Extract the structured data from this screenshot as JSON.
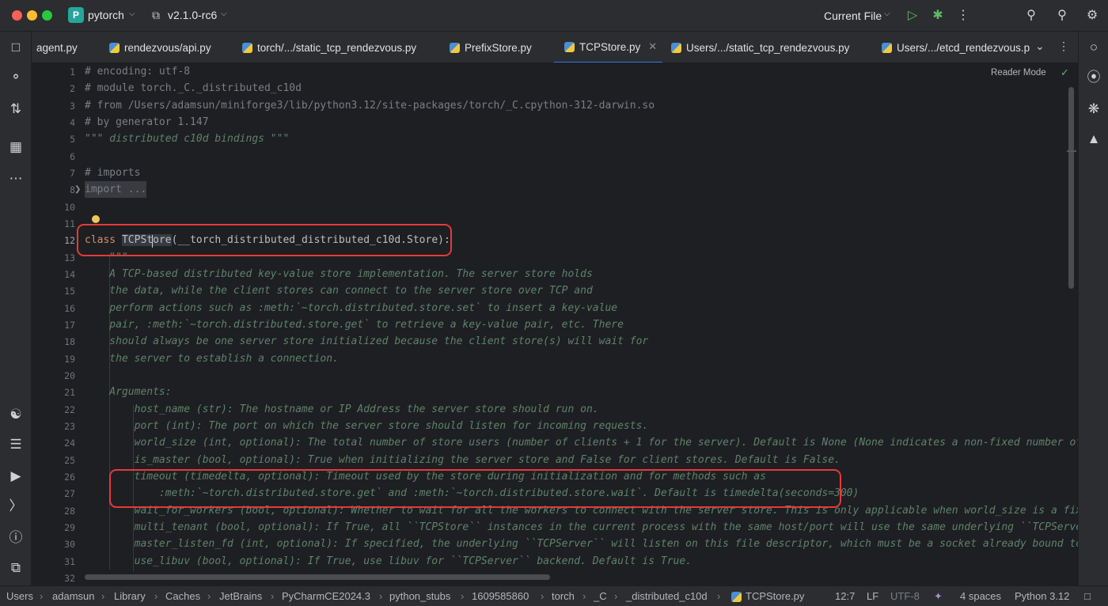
{
  "titlebar": {
    "project_badge": "P",
    "project_name": "pytorch",
    "branch": "v2.1.0-rc6",
    "run_config": "Current File"
  },
  "tabs": [
    {
      "label": "agent.py",
      "active": false
    },
    {
      "label": "rendezvous/api.py",
      "active": false
    },
    {
      "label": "torch/.../static_tcp_rendezvous.py",
      "active": false
    },
    {
      "label": "PrefixStore.py",
      "active": false
    },
    {
      "label": "TCPStore.py",
      "active": true
    },
    {
      "label": "Users/.../static_tcp_rendezvous.py",
      "active": false
    },
    {
      "label": "Users/.../etcd_rendezvous.p",
      "active": false
    }
  ],
  "editor": {
    "reader_mode": "Reader Mode",
    "line_numbers": [
      "1",
      "2",
      "3",
      "4",
      "5",
      "6",
      "7",
      "8",
      "10",
      "11",
      "12",
      "13",
      "14",
      "15",
      "16",
      "17",
      "18",
      "19",
      "20",
      "21",
      "22",
      "23",
      "24",
      "25",
      "26",
      "27",
      "28",
      "29",
      "30",
      "31",
      "32"
    ],
    "lines": {
      "l1": "# encoding: utf-8",
      "l2": "# module torch._C._distributed_c10d",
      "l3": "# from /Users/adamsun/miniforge3/lib/python3.12/site-packages/torch/_C.cpython-312-darwin.so",
      "l4": "# by generator 1.147",
      "l5": "\"\"\" distributed c10d bindings \"\"\"",
      "l7": "# imports",
      "l8": "import ...",
      "l12_kw": "class ",
      "l12_name": "TCPStore",
      "l12_rest": "(__torch_distributed_distributed_c10d.Store):",
      "l13": "    \"\"\"",
      "l14": "    A TCP-based distributed key-value store implementation. The server store holds",
      "l15": "    the data, while the client stores can connect to the server store over TCP and",
      "l16": "    perform actions such as :meth:`~torch.distributed.store.set` to insert a key-value",
      "l17": "    pair, :meth:`~torch.distributed.store.get` to retrieve a key-value pair, etc. There",
      "l18": "    should always be one server store initialized because the client store(s) will wait for",
      "l19": "    the server to establish a connection.",
      "l21": "    Arguments:",
      "l22": "        host_name (str): The hostname or IP Address the server store should run on.",
      "l23": "        port (int): The port on which the server store should listen for incoming requests.",
      "l24": "        world_size (int, optional): The total number of store users (number of clients + 1 for the server). Default is None (None indicates a non-fixed number of sto",
      "l25": "        is_master (bool, optional): True when initializing the server store and False for client stores. Default is False.",
      "l26": "        timeout (timedelta, optional): Timeout used by the store during initialization and for methods such as",
      "l27": "            :meth:`~torch.distributed.store.get` and :meth:`~torch.distributed.store.wait`. Default is timedelta(seconds=300)",
      "l28": "        wait_for_workers (bool, optional): Whether to wait for all the workers to connect with the server store. This is only applicable when world_size is a fixed v",
      "l29": "        multi_tenant (bool, optional): If True, all ``TCPStore`` instances in the current process with the same host/port will use the same underlying ``TCPServer``.",
      "l30": "        master_listen_fd (int, optional): If specified, the underlying ``TCPServer`` will listen on this file descriptor, which must be a socket already bound to ``p",
      "l31": "        use_libuv (bool, optional): If True, use libuv for ``TCPServer`` backend. Default is True."
    }
  },
  "breadcrumb": [
    "Users",
    "adamsun",
    "Library",
    "Caches",
    "JetBrains",
    "PyCharmCE2024.3",
    "python_stubs",
    "1609585860",
    "torch",
    "_C",
    "_distributed_c10d",
    "TCPStore.py"
  ],
  "status": {
    "position": "12:7",
    "line_sep": "LF",
    "encoding": "UTF-8",
    "indent": "4 spaces",
    "interpreter": "Python 3.12"
  },
  "colors": {
    "accent": "#3574f0",
    "highlight_box": "#e53a3a",
    "run_green": "#5fb865"
  }
}
